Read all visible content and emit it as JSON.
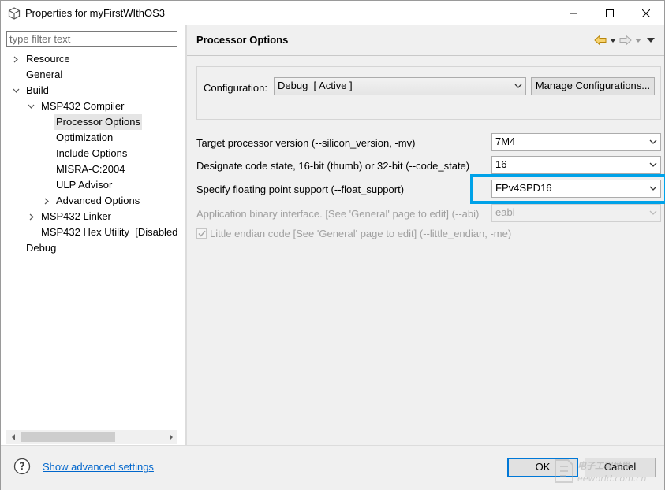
{
  "window": {
    "title": "Properties for myFirstWIthOS3",
    "icons": {
      "app": "cube-icon",
      "minimize": "minimize-icon",
      "maximize": "maximize-icon",
      "close": "close-icon"
    }
  },
  "sidebar": {
    "filter_placeholder": "type filter text",
    "items": [
      {
        "label": "Resource",
        "expander": "collapsed"
      },
      {
        "label": "General",
        "expander": "none"
      },
      {
        "label": "Build",
        "expander": "expanded"
      },
      {
        "label": "MSP432 Compiler",
        "expander": "expanded"
      },
      {
        "label": "Processor Options",
        "expander": "none",
        "selected": true
      },
      {
        "label": "Optimization",
        "expander": "none"
      },
      {
        "label": "Include Options",
        "expander": "none"
      },
      {
        "label": "MISRA-C:2004",
        "expander": "none"
      },
      {
        "label": "ULP Advisor",
        "expander": "none"
      },
      {
        "label": "Advanced Options",
        "expander": "collapsed"
      },
      {
        "label": "MSP432 Linker",
        "expander": "collapsed"
      },
      {
        "label": "MSP432 Hex Utility  [Disabled",
        "expander": "none"
      },
      {
        "label": "Debug",
        "expander": "none"
      }
    ]
  },
  "page": {
    "title": "Processor Options",
    "nav_icons": [
      "back-arrow-icon",
      "forward-arrow-icon",
      "view-menu-icon"
    ]
  },
  "configuration": {
    "label": "Configuration:",
    "value": "Debug  [ Active ]",
    "manage_button": "Manage Configurations..."
  },
  "options": [
    {
      "label": "Target processor version (--silicon_version, -mv)",
      "value": "7M4",
      "enabled": true
    },
    {
      "label": "Designate code state, 16-bit (thumb) or 32-bit (--code_state)",
      "value": "16",
      "enabled": true
    },
    {
      "label": "Specify floating point support (--float_support)",
      "value": "FPv4SPD16",
      "enabled": true,
      "highlighted": true
    },
    {
      "label": "Application binary interface. [See 'General' page to edit] (--abi)",
      "value": "eabi",
      "enabled": false
    }
  ],
  "endian_checkbox": {
    "label": "Little endian code [See 'General' page to edit] (--little_endian, -me)",
    "checked": true,
    "enabled": false
  },
  "footer": {
    "advanced_link": "Show advanced settings",
    "ok_label": "OK",
    "cancel_label": "Cancel"
  },
  "watermark": {
    "title": "电子工程世界",
    "url": "eeworld.com.cn"
  },
  "colors": {
    "highlight": "#00a2e8",
    "link": "#0066cc",
    "default_button_border": "#0078d7"
  }
}
